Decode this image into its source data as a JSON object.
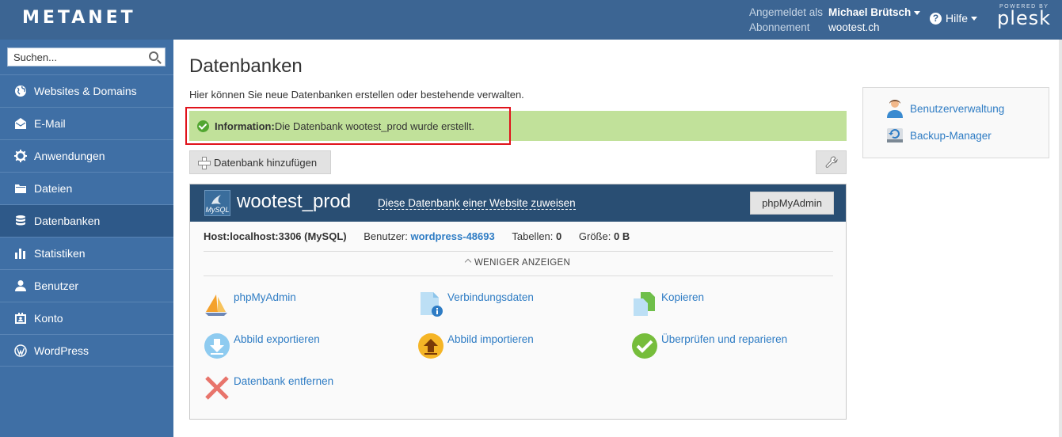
{
  "header": {
    "logo": "METANET",
    "logged_in_label": "Angemeldet als",
    "user_name": "Michael Brütsch",
    "subscription_label": "Abonnement",
    "subscription_value": "wootest.ch",
    "help_label": "Hilfe",
    "powered_by": "POWERED BY",
    "plesk": "plesk"
  },
  "sidebar": {
    "search_placeholder": "Suchen...",
    "items": [
      {
        "label": "Websites & Domains",
        "icon": "globe-icon"
      },
      {
        "label": "E-Mail",
        "icon": "mail-icon"
      },
      {
        "label": "Anwendungen",
        "icon": "gear-icon"
      },
      {
        "label": "Dateien",
        "icon": "folder-icon"
      },
      {
        "label": "Datenbanken",
        "icon": "database-icon",
        "active": true
      },
      {
        "label": "Statistiken",
        "icon": "bar-chart-icon"
      },
      {
        "label": "Benutzer",
        "icon": "user-icon"
      },
      {
        "label": "Konto",
        "icon": "account-icon"
      },
      {
        "label": "WordPress",
        "icon": "wordpress-icon"
      }
    ]
  },
  "main": {
    "title": "Datenbanken",
    "description": "Hier können Sie neue Datenbanken erstellen oder bestehende verwalten.",
    "message_prefix": "Information:",
    "message_text": " Die Datenbank wootest_prod wurde erstellt.",
    "add_db_label": "Datenbank hinzufügen",
    "database": {
      "logo_text": "MySQL",
      "name": "wootest_prod",
      "assign_link": "Diese Datenbank einer Website zuweisen",
      "phpmyadmin_button": "phpMyAdmin",
      "host_label": "Host:",
      "host_value": "localhost:3306 (MySQL)",
      "user_label": "Benutzer:",
      "user_value": "wordpress-48693",
      "tables_label": "Tabellen:",
      "tables_value": "0",
      "size_label": "Größe:",
      "size_value": "0 B",
      "less_label": "WENIGER ANZEIGEN",
      "actions": [
        {
          "label": "phpMyAdmin",
          "icon": "phpmyadmin-icon"
        },
        {
          "label": "Verbindungsdaten",
          "icon": "connection-info-icon"
        },
        {
          "label": "Kopieren",
          "icon": "copy-icon"
        },
        {
          "label": "Abbild exportieren",
          "icon": "export-icon"
        },
        {
          "label": "Abbild importieren",
          "icon": "import-icon"
        },
        {
          "label": "Überprüfen und reparieren",
          "icon": "check-repair-icon"
        },
        {
          "label": "Datenbank entfernen",
          "icon": "remove-icon"
        }
      ]
    }
  },
  "right_panel": {
    "items": [
      {
        "label": "Benutzerverwaltung",
        "icon": "user-management-icon"
      },
      {
        "label": "Backup-Manager",
        "icon": "backup-icon"
      }
    ]
  },
  "colors": {
    "header_bg": "#3c6593",
    "sidebar_bg": "#3f6fa5",
    "sidebar_active": "#2e5989",
    "message_bg": "#c1e19a",
    "db_header_bg": "#294e73",
    "link": "#2e7cc4",
    "highlight": "#e0131b"
  }
}
